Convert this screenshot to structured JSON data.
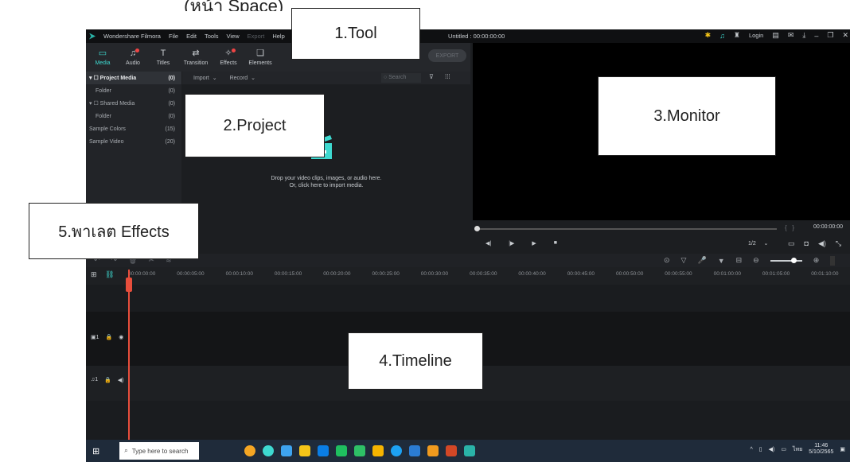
{
  "caption_fragment": "ู         (หน้า Space)",
  "app": {
    "name": "Wondershare Filmora",
    "menu": [
      "File",
      "Edit",
      "Tools",
      "View",
      "Export",
      "Help"
    ],
    "project_title": "Untitled : 00:00:00:00",
    "login": "Login",
    "export_button": "EXPORT"
  },
  "toolbar": [
    {
      "label": "Media",
      "icon": "folder-icon"
    },
    {
      "label": "Audio",
      "icon": "music-icon"
    },
    {
      "label": "Titles",
      "icon": "text-icon"
    },
    {
      "label": "Transition",
      "icon": "transition-icon"
    },
    {
      "label": "Effects",
      "icon": "effects-icon"
    },
    {
      "label": "Elements",
      "icon": "elements-icon"
    }
  ],
  "sidebar": [
    {
      "label": "▾ ☐ Project Media",
      "count": "(0)"
    },
    {
      "label": "Folder",
      "count": "(0)"
    },
    {
      "label": "▾ ☐ Shared Media",
      "count": "(0)"
    },
    {
      "label": "Folder",
      "count": "(0)"
    },
    {
      "label": "Sample Colors",
      "count": "(15)"
    },
    {
      "label": "Sample Video",
      "count": "(20)"
    }
  ],
  "media": {
    "import": "Import",
    "record": "Record",
    "search_placeholder": "Search",
    "drop_line1": "Drop your video clips, images, or audio here.",
    "drop_line2": "Or, click here to import media."
  },
  "monitor": {
    "time": "00:00:00:00",
    "ratio": "1/2"
  },
  "timeline": {
    "ticks": [
      "00:00:00:00",
      "00:00:05:00",
      "00:00:10:00",
      "00:00:15:00",
      "00:00:20:00",
      "00:00:25:00",
      "00:00:30:00",
      "00:00:35:00",
      "00:00:40:00",
      "00:00:45:00",
      "00:00:50:00",
      "00:00:55:00",
      "00:01:00:00",
      "00:01:05:00",
      "00:01:10:00"
    ]
  },
  "taskbar": {
    "search": "Type here to search",
    "time": "11:46",
    "date": "5/10/2565",
    "lang": "ไทย"
  },
  "labels": {
    "tool": "1.Tool",
    "project": "2.Project",
    "monitor": "3.Monitor",
    "timeline": "4.Timeline",
    "effects": "5.พาเลต Effects"
  }
}
